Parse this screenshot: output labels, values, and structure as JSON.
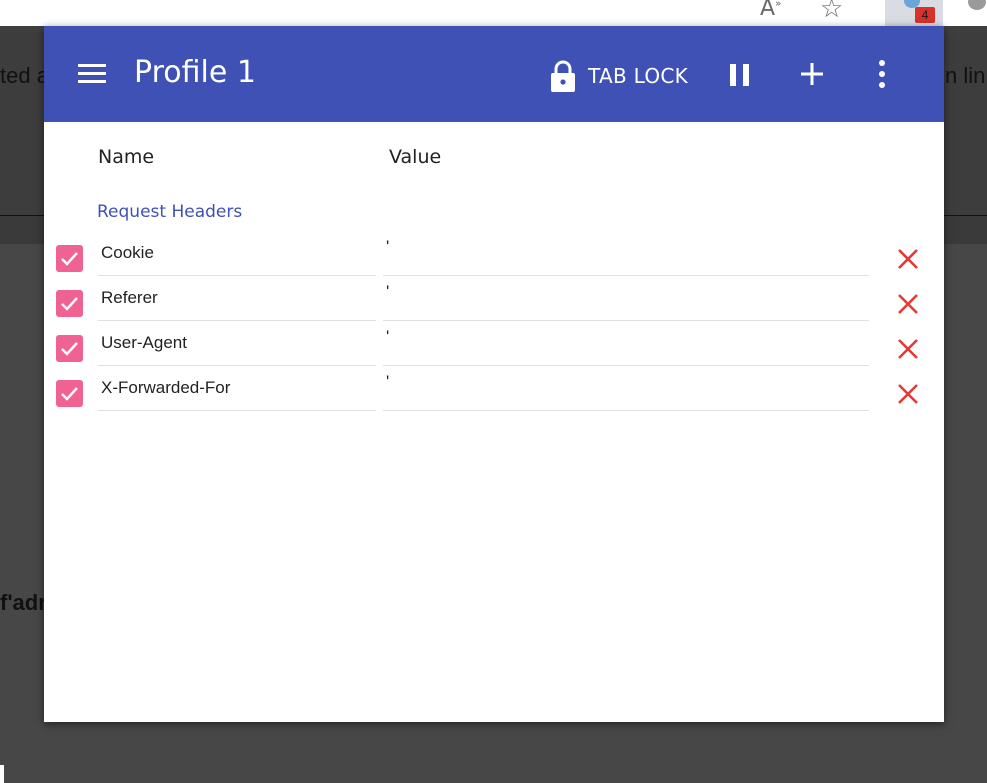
{
  "browser": {
    "read_aloud_icon": "read-aloud-icon",
    "star_icon": "star-icon",
    "extension_badge": "4"
  },
  "background_page": {
    "text_left": "ted a",
    "text_right": "n lin",
    "text_bold": "f'adr"
  },
  "popup": {
    "title": "Profile 1",
    "tab_lock_label": "TAB LOCK",
    "columns": {
      "name": "Name",
      "value": "Value"
    },
    "section_label": "Request Headers",
    "accent_color": "#3f51b5",
    "checkbox_color": "#f06292",
    "delete_color": "#e53935",
    "headers": [
      {
        "name": "Cookie",
        "value": "'",
        "enabled": true
      },
      {
        "name": "Referer",
        "value": "'",
        "enabled": true
      },
      {
        "name": "User-Agent",
        "value": "'",
        "enabled": true
      },
      {
        "name": "X-Forwarded-For",
        "value": "'",
        "enabled": true
      }
    ]
  }
}
